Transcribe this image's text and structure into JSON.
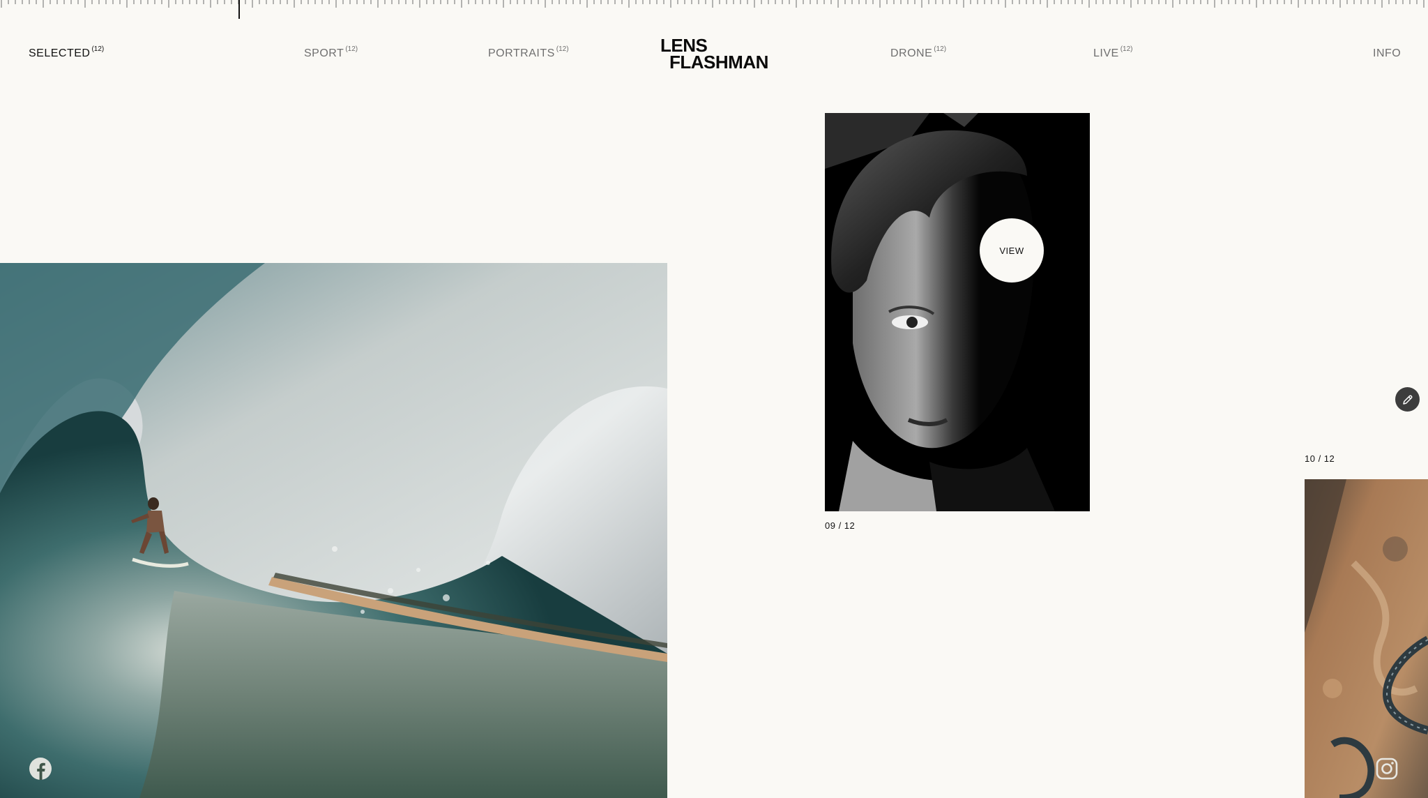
{
  "header": {
    "logo_line1": "LENS",
    "logo_line2": "FLASHMAN",
    "nav": [
      {
        "label": "SELECTED",
        "count": "(12)",
        "active": true
      },
      {
        "label": "SPORT",
        "count": "(12)",
        "active": false
      },
      {
        "label": "PORTRAITS",
        "count": "(12)",
        "active": false
      },
      {
        "label": "DRONE",
        "count": "(12)",
        "active": false
      },
      {
        "label": "LIVE",
        "count": "(12)",
        "active": false
      }
    ],
    "info_label": "INFO"
  },
  "gallery": {
    "view_label": "VIEW",
    "items": [
      {
        "name": "surf-photo",
        "counter": ""
      },
      {
        "name": "portrait-photo",
        "counter": "09 / 12"
      },
      {
        "name": "drone-photo",
        "counter": "10 / 12"
      }
    ]
  },
  "icons": {
    "edit": "pencil-icon",
    "facebook": "facebook-icon",
    "instagram": "instagram-icon"
  },
  "colors": {
    "background": "#faf9f5",
    "text": "#111111",
    "muted": "#6f6f6f"
  }
}
